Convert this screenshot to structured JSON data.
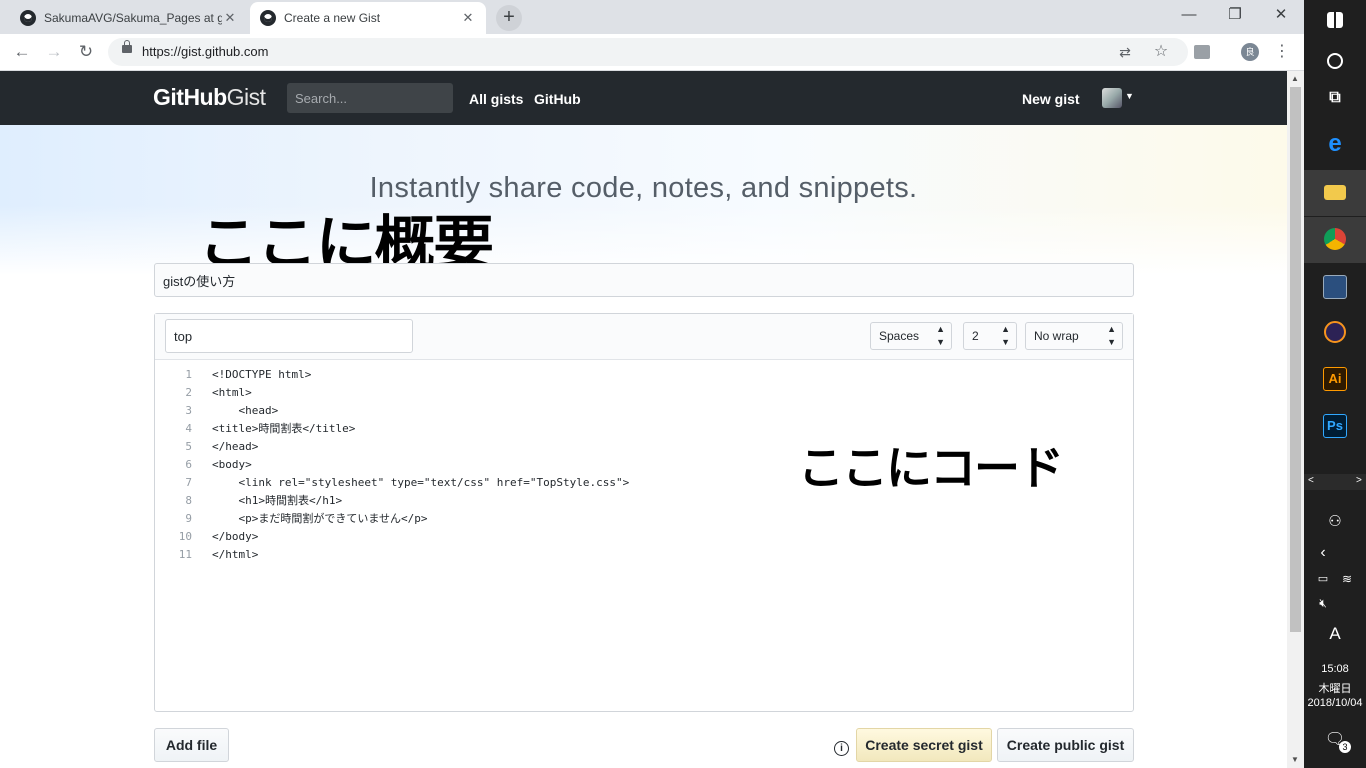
{
  "browser": {
    "tabs": [
      {
        "title": "SakumaAVG/Sakuma_Pages at gi",
        "active": false
      },
      {
        "title": "Create a new Gist",
        "active": true
      }
    ],
    "new_tab_symbol": "+",
    "url": "https://gist.github.com",
    "window_controls": {
      "minimize": "—",
      "maximize": "❐",
      "close": "✕"
    }
  },
  "header": {
    "logo_bold": "GitHub",
    "logo_light": "Gist",
    "search_placeholder": "Search...",
    "nav": [
      "All gists",
      "GitHub"
    ],
    "new_gist": "New gist"
  },
  "hero": {
    "tagline": "Instantly share code, notes, and snippets."
  },
  "annotations": {
    "description_note": "ここに概要",
    "code_note": "ここにコード"
  },
  "form": {
    "description_value": "gistの使い方",
    "filename_value": "top",
    "indent_mode": "Spaces",
    "indent_size": "2",
    "wrap_mode": "No wrap"
  },
  "code_lines": [
    {
      "n": "1",
      "text": "<!DOCTYPE html>"
    },
    {
      "n": "2",
      "text": "<html>"
    },
    {
      "n": "3",
      "text": "    <head>"
    },
    {
      "n": "4",
      "text": "<title>時間割表</title>"
    },
    {
      "n": "5",
      "text": "</head>"
    },
    {
      "n": "6",
      "text": "<body>"
    },
    {
      "n": "7",
      "text": "    <link rel=\"stylesheet\" type=\"text/css\" href=\"TopStyle.css\">"
    },
    {
      "n": "8",
      "text": "    <h1>時間割表</h1>"
    },
    {
      "n": "9",
      "text": "    <p>まだ時間割ができていません</p>"
    },
    {
      "n": "10",
      "text": "</body>"
    },
    {
      "n": "11",
      "text": "</html>"
    }
  ],
  "buttons": {
    "add_file": "Add file",
    "create_secret": "Create secret gist",
    "create_public": "Create public gist"
  },
  "taskbar": {
    "time": "15:08",
    "weekday": "木曜日",
    "date": "2018/10/04",
    "ime": "A",
    "notification_count": "3",
    "apps": [
      "windows-logo",
      "cortana",
      "task-view",
      "edge",
      "file-explorer",
      "chrome",
      "mysql-workbench",
      "eclipse",
      "illustrator",
      "photoshop"
    ],
    "app_labels": {
      "illustrator": "Ai",
      "photoshop": "Ps",
      "edge": "e"
    }
  }
}
